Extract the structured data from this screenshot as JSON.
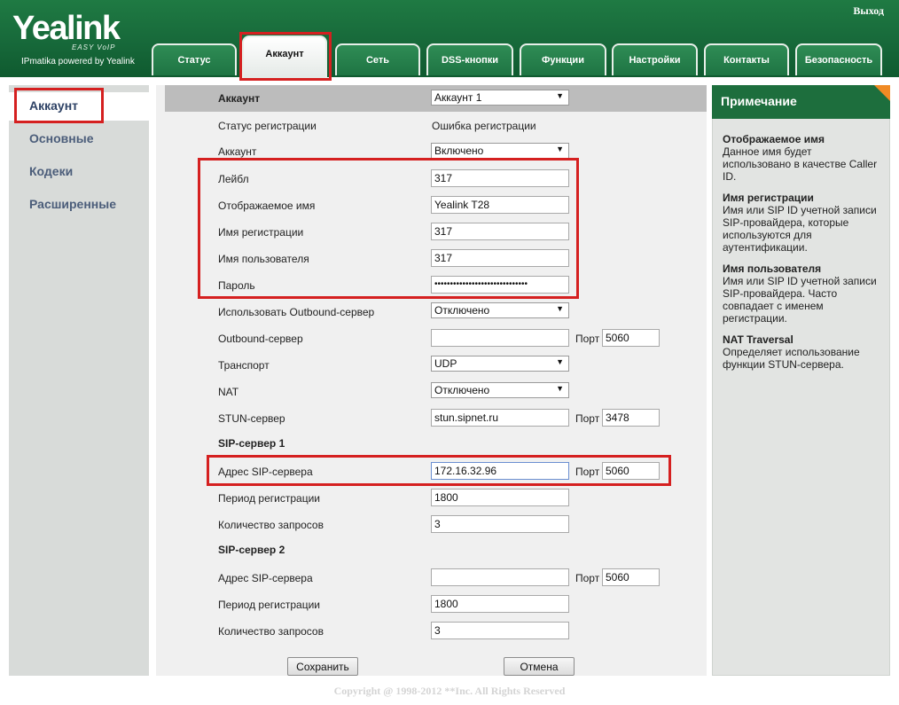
{
  "header": {
    "logo": "Yealink",
    "logo_tagline": "EASY VoIP",
    "logo_sub": "IPmatika powered by Yealink",
    "logout": "Выход"
  },
  "tabs": [
    {
      "label": "Статус"
    },
    {
      "label": "Аккаунт",
      "active": true
    },
    {
      "label": "Сеть"
    },
    {
      "label": "DSS-кнопки"
    },
    {
      "label": "Функции"
    },
    {
      "label": "Настройки"
    },
    {
      "label": "Контакты"
    },
    {
      "label": "Безопасность"
    }
  ],
  "sidebar": {
    "items": [
      {
        "label": "Аккаунт",
        "active": true
      },
      {
        "label": "Основные"
      },
      {
        "label": "Кодеки"
      },
      {
        "label": "Расширенные"
      }
    ]
  },
  "form": {
    "account_label": "Аккаунт",
    "account_select": "Аккаунт 1",
    "reg_status_label": "Статус регистрации",
    "reg_status_value": "Ошибка регистрации",
    "account_enabled_label": "Аккаунт",
    "account_enabled_value": "Включено",
    "label_label": "Лейбл",
    "label_value": "317",
    "display_name_label": "Отображаемое имя",
    "display_name_value": "Yealink T28",
    "reg_name_label": "Имя регистрации",
    "reg_name_value": "317",
    "user_name_label": "Имя пользователя",
    "user_name_value": "317",
    "password_label": "Пароль",
    "password_value": "••••••••••••••••••••••••••••••",
    "outbound_use_label": "Использовать Outbound-сервер",
    "outbound_use_value": "Отключено",
    "outbound_server_label": "Outbound-сервер",
    "outbound_server_value": "",
    "outbound_port_label": "Порт",
    "outbound_port_value": "5060",
    "transport_label": "Транспорт",
    "transport_value": "UDP",
    "nat_label": "NAT",
    "nat_value": "Отключено",
    "stun_label": "STUN-сервер",
    "stun_value": "stun.sipnet.ru",
    "stun_port_label": "Порт",
    "stun_port_value": "3478",
    "sip1_section": "SIP-сервер 1",
    "sip1_addr_label": "Адрес SIP-сервера",
    "sip1_addr_value": "172.16.32.96",
    "sip1_port_label": "Порт",
    "sip1_port_value": "5060",
    "sip1_period_label": "Период регистрации",
    "sip1_period_value": "1800",
    "sip1_retries_label": "Количество запросов",
    "sip1_retries_value": "3",
    "sip2_section": "SIP-сервер 2",
    "sip2_addr_label": "Адрес SIP-сервера",
    "sip2_addr_value": "",
    "sip2_port_label": "Порт",
    "sip2_port_value": "5060",
    "sip2_period_label": "Период регистрации",
    "sip2_period_value": "1800",
    "sip2_retries_label": "Количество запросов",
    "sip2_retries_value": "3",
    "save_button": "Сохранить",
    "cancel_button": "Отмена"
  },
  "note": {
    "title": "Примечание",
    "blocks": [
      {
        "title": "Отображаемое имя",
        "text": "Данное имя будет использовано в качестве Caller ID."
      },
      {
        "title": "Имя регистрации",
        "text": "Имя или SIP ID учетной записи SIP-провайдера, которые используются для аутентификации."
      },
      {
        "title": "Имя пользователя",
        "text": "Имя или SIP ID учетной записи SIP-провайдера. Часто совпадает с именем регистрации."
      },
      {
        "title": "NAT Traversal",
        "text": "Определяет использование функции STUN-сервера."
      }
    ]
  },
  "footer": {
    "copyright": "Copyright @ 1998-2012 **Inc. All Rights Reserved"
  },
  "colors": {
    "brand_green": "#1d6e3d",
    "highlight_red": "#d52020",
    "note_corner": "#f08a24"
  }
}
